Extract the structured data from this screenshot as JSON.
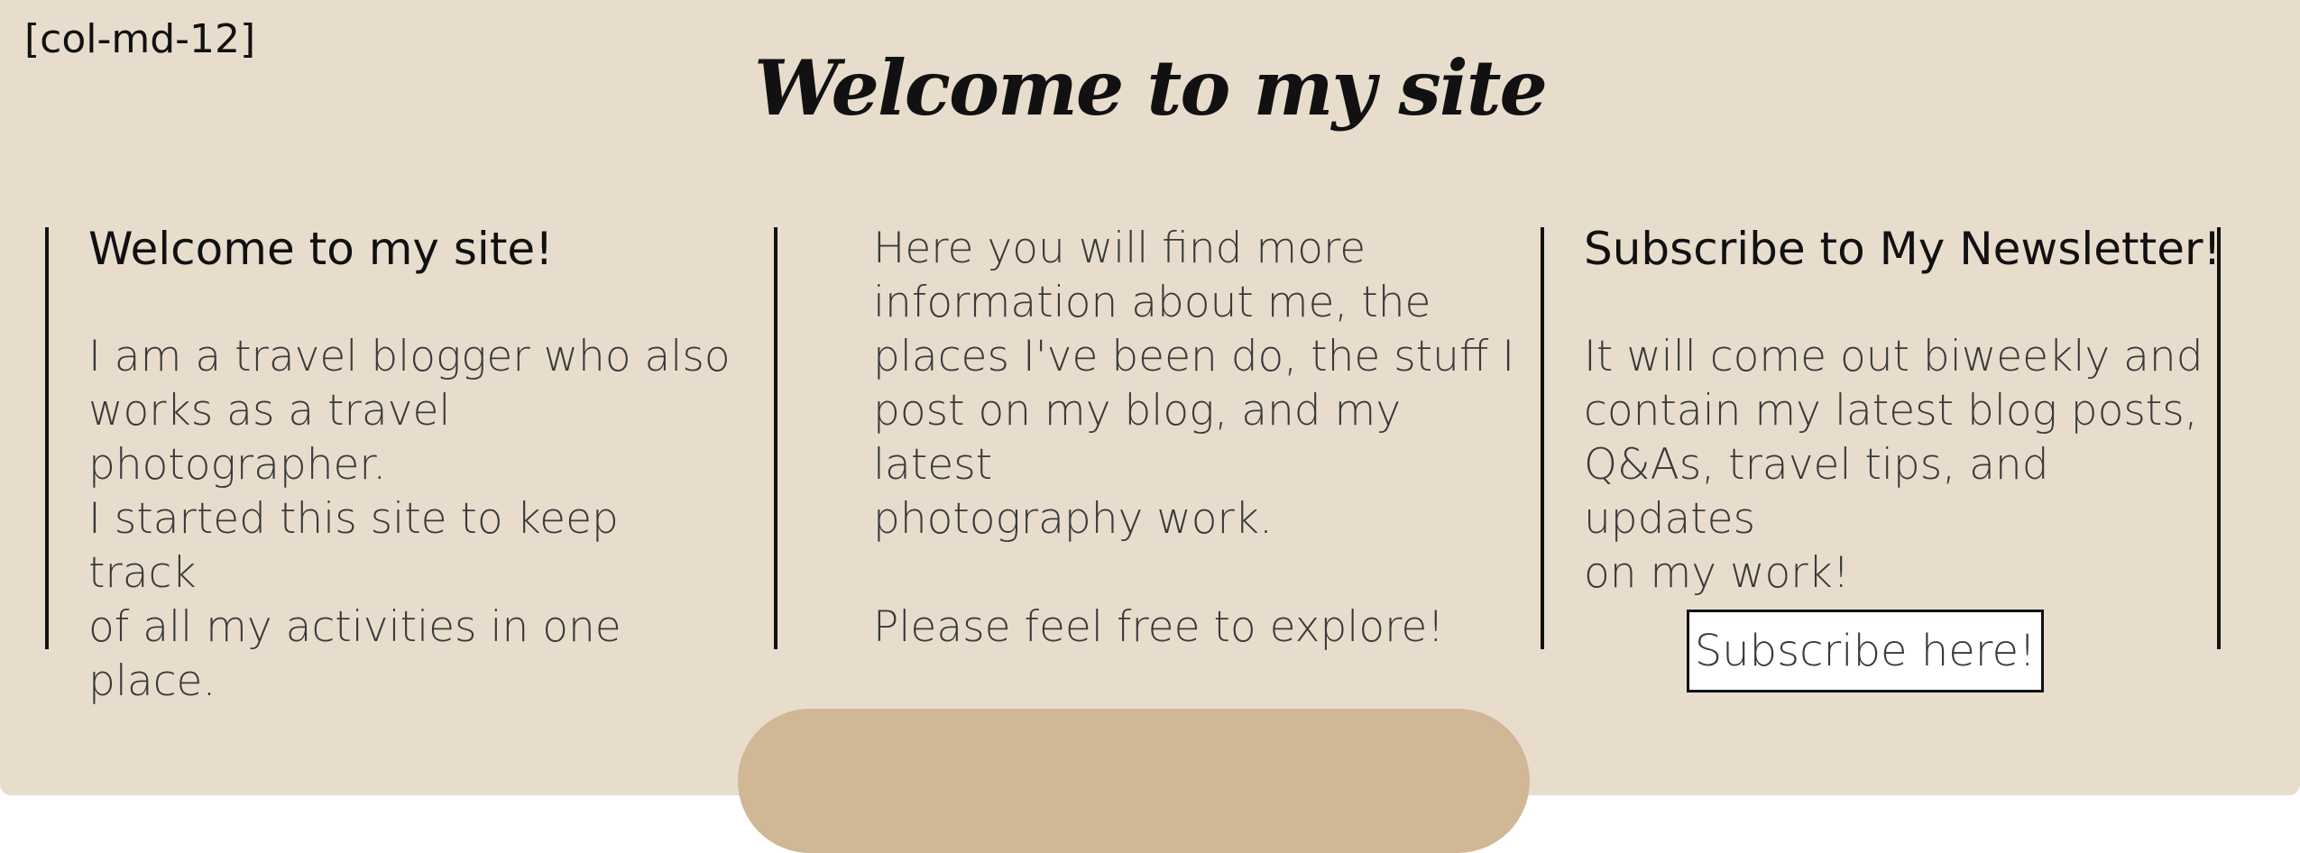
{
  "layout_tag": "[col-md-12]",
  "page_title": "Welcome to my site",
  "columns": [
    {
      "heading": "Welcome to my site!",
      "paragraphs": [
        "I am a travel blogger who also\nworks as a travel photographer.\nI started this site to keep track\nof all my activities in one place."
      ]
    },
    {
      "paragraphs": [
        "Here you will find more\n information about me, the\nplaces I've been do, the stuff I\npost on my blog, and my latest\nphotography work.",
        "Please feel free to explore!"
      ]
    },
    {
      "heading": "Subscribe to My Newsletter!",
      "paragraphs": [
        "It will come out biweekly and\ncontain my latest blog posts,\nQ&As, travel tips, and updates\non my work!"
      ],
      "button_label": "Subscribe here!"
    }
  ],
  "colors": {
    "panel_background": "#e8ddcd",
    "pill_accent": "#d0b795",
    "divider": "#111111"
  }
}
